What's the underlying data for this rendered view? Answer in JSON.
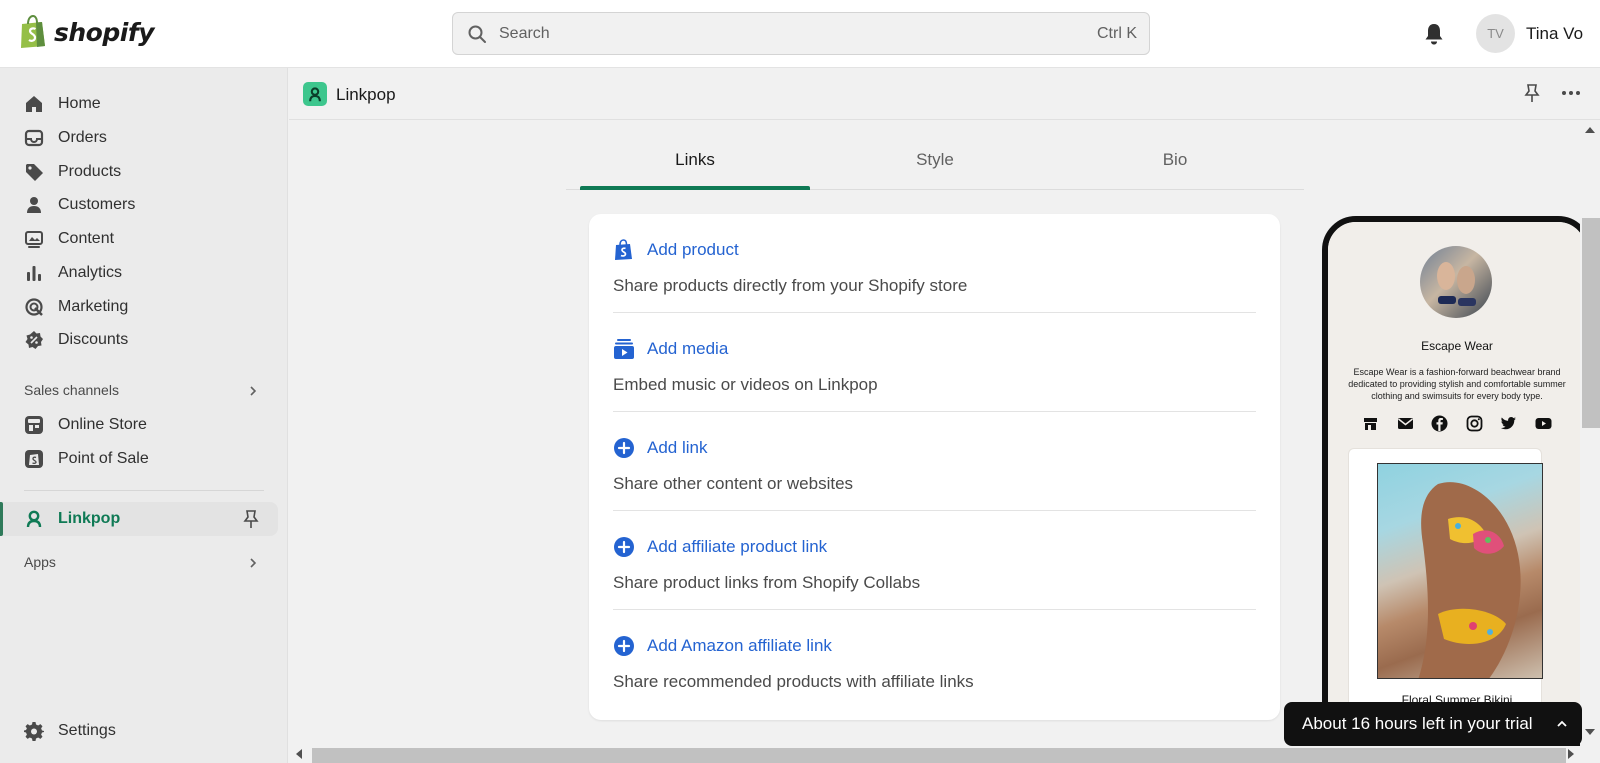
{
  "topbar": {
    "logo_text": "shopify",
    "search_placeholder": "Search",
    "search_shortcut": "Ctrl K",
    "user_initials": "TV",
    "user_name": "Tina Vo"
  },
  "sidebar": {
    "items": [
      {
        "label": "Home",
        "icon": "home-icon"
      },
      {
        "label": "Orders",
        "icon": "orders-icon"
      },
      {
        "label": "Products",
        "icon": "tag-icon"
      },
      {
        "label": "Customers",
        "icon": "person-icon"
      },
      {
        "label": "Content",
        "icon": "content-icon"
      },
      {
        "label": "Analytics",
        "icon": "bar-chart-icon"
      },
      {
        "label": "Marketing",
        "icon": "target-icon"
      },
      {
        "label": "Discounts",
        "icon": "discount-icon"
      }
    ],
    "sales_channels_label": "Sales channels",
    "channels": [
      {
        "label": "Online Store",
        "icon": "store-icon"
      },
      {
        "label": "Point of Sale",
        "icon": "pos-icon"
      }
    ],
    "active_app": "Linkpop",
    "apps_label": "Apps",
    "settings_label": "Settings",
    "active_color": "#0f7a55"
  },
  "app_header": {
    "title": "Linkpop"
  },
  "tabs": [
    {
      "label": "Links",
      "active": true
    },
    {
      "label": "Style",
      "active": false
    },
    {
      "label": "Bio",
      "active": false
    }
  ],
  "options": [
    {
      "title": "Add product",
      "description": "Share products directly from your Shopify store",
      "icon": "shopify-bag-icon"
    },
    {
      "title": "Add media",
      "description": "Embed music or videos on Linkpop",
      "icon": "media-icon"
    },
    {
      "title": "Add link",
      "description": "Share other content or websites",
      "icon": "plus-circle-icon"
    },
    {
      "title": "Add affiliate product link",
      "description": "Share product links from Shopify Collabs",
      "icon": "plus-circle-icon"
    },
    {
      "title": "Add Amazon affiliate link",
      "description": "Share recommended products with affiliate links",
      "icon": "plus-circle-icon"
    }
  ],
  "link_color": "#2463d1",
  "preview": {
    "profile_name": "Escape Wear",
    "bio": "Escape Wear is a fashion-forward beachwear brand dedicated to providing stylish and comfortable summer clothing and swimsuits for every body type.",
    "social_icons": [
      "store-icon",
      "mail-icon",
      "facebook-icon",
      "instagram-icon",
      "twitter-icon",
      "youtube-icon"
    ],
    "product_name": "Floral Summer Bikini"
  },
  "trial": {
    "text": "About 16 hours left in your trial"
  }
}
